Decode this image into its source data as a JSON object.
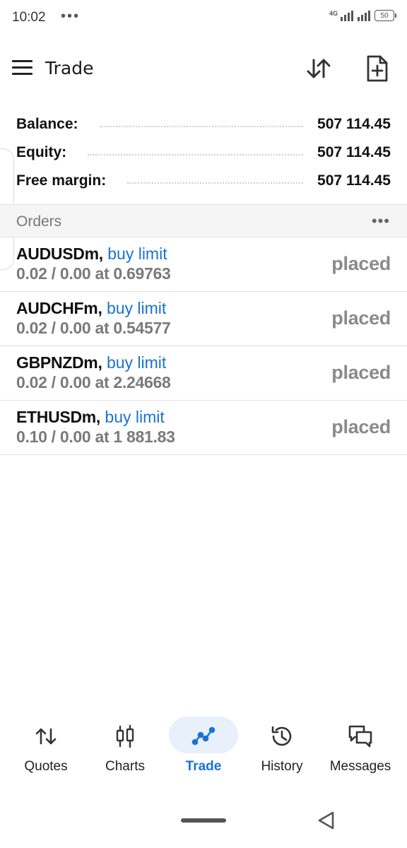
{
  "status_bar": {
    "time": "10:02",
    "dots": "•••",
    "network": "4G",
    "battery": "50"
  },
  "header": {
    "title": "Trade",
    "icons": [
      "menu-icon",
      "sort-arrows-icon",
      "new-document-icon"
    ]
  },
  "summary": [
    {
      "label": "Balance:",
      "value": "507 114.45"
    },
    {
      "label": "Equity:",
      "value": "507 114.45"
    },
    {
      "label": "Free margin:",
      "value": "507 114.45"
    }
  ],
  "orders": {
    "title": "Orders",
    "more": "•••",
    "items": [
      {
        "symbol": "AUDUSDm,",
        "type": "buy limit",
        "detail": "0.02 / 0.00 at 0.69763",
        "status": "placed"
      },
      {
        "symbol": "AUDCHFm,",
        "type": "buy limit",
        "detail": "0.02 / 0.00 at 0.54577",
        "status": "placed"
      },
      {
        "symbol": "GBPNZDm,",
        "type": "buy limit",
        "detail": "0.02 / 0.00 at 2.24668",
        "status": "placed"
      },
      {
        "symbol": "ETHUSDm,",
        "type": "buy limit",
        "detail": "0.10 / 0.00 at 1 881.83",
        "status": "placed"
      }
    ]
  },
  "bottom_nav": {
    "active": "Trade",
    "items": [
      {
        "label": "Quotes",
        "icon": "quotes-arrows-icon"
      },
      {
        "label": "Charts",
        "icon": "candlestick-icon"
      },
      {
        "label": "Trade",
        "icon": "trade-line-icon"
      },
      {
        "label": "History",
        "icon": "history-clock-icon"
      },
      {
        "label": "Messages",
        "icon": "messages-icon"
      }
    ]
  },
  "colors": {
    "accent": "#1a73d0",
    "active_pill": "#e8f0fb",
    "muted_text": "#7a7a7a",
    "section_bg": "#f5f5f5"
  }
}
